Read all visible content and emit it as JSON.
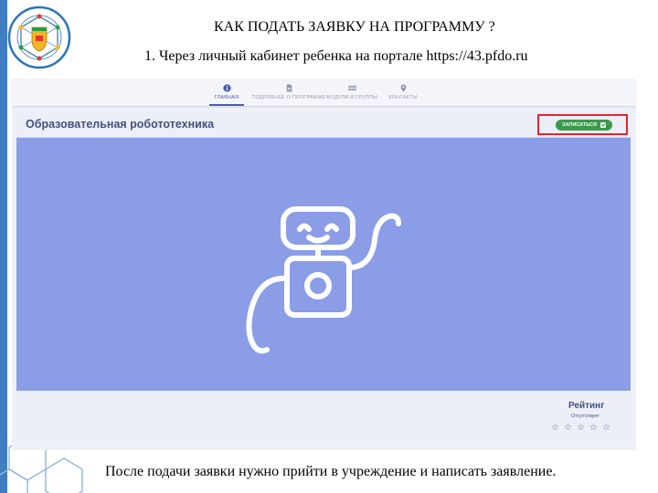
{
  "slide": {
    "heading": "КАК ПОДАТЬ ЗАЯВКУ НА ПРОГРАММУ ?",
    "subheading": "1. Через личный кабинет ребенка на портале https://43.pfdo.ru",
    "footer": "После подачи заявки нужно прийти в учреждение и написать заявление."
  },
  "portal": {
    "nav": {
      "items": [
        {
          "label": "ГЛАВНАЯ",
          "icon": "info-icon",
          "active": true
        },
        {
          "label": "ПОДРОБНЕЕ О ПРОГРАММЕ",
          "icon": "document-icon",
          "active": false
        },
        {
          "label": "МОДУЛИ И ГРУППЫ",
          "icon": "grid-icon",
          "active": false
        },
        {
          "label": "КОНТАКТЫ",
          "icon": "location-pin-icon",
          "active": false
        }
      ]
    },
    "program": {
      "title": "Образовательная робототехника",
      "enroll_label": "ЗАПИСАТЬСЯ"
    },
    "rating": {
      "title": "Рейтинг",
      "status": "Отсутствует",
      "stars": [
        "☆",
        "☆",
        "☆",
        "☆",
        "☆"
      ],
      "value": 0,
      "max": 5
    }
  },
  "colors": {
    "accent": "#4a5eb0",
    "hero_bg": "#8a9de6",
    "enroll_button": "#3a9a4a",
    "highlight_frame": "#e0282e",
    "slide_band": "#3f7fc1"
  }
}
